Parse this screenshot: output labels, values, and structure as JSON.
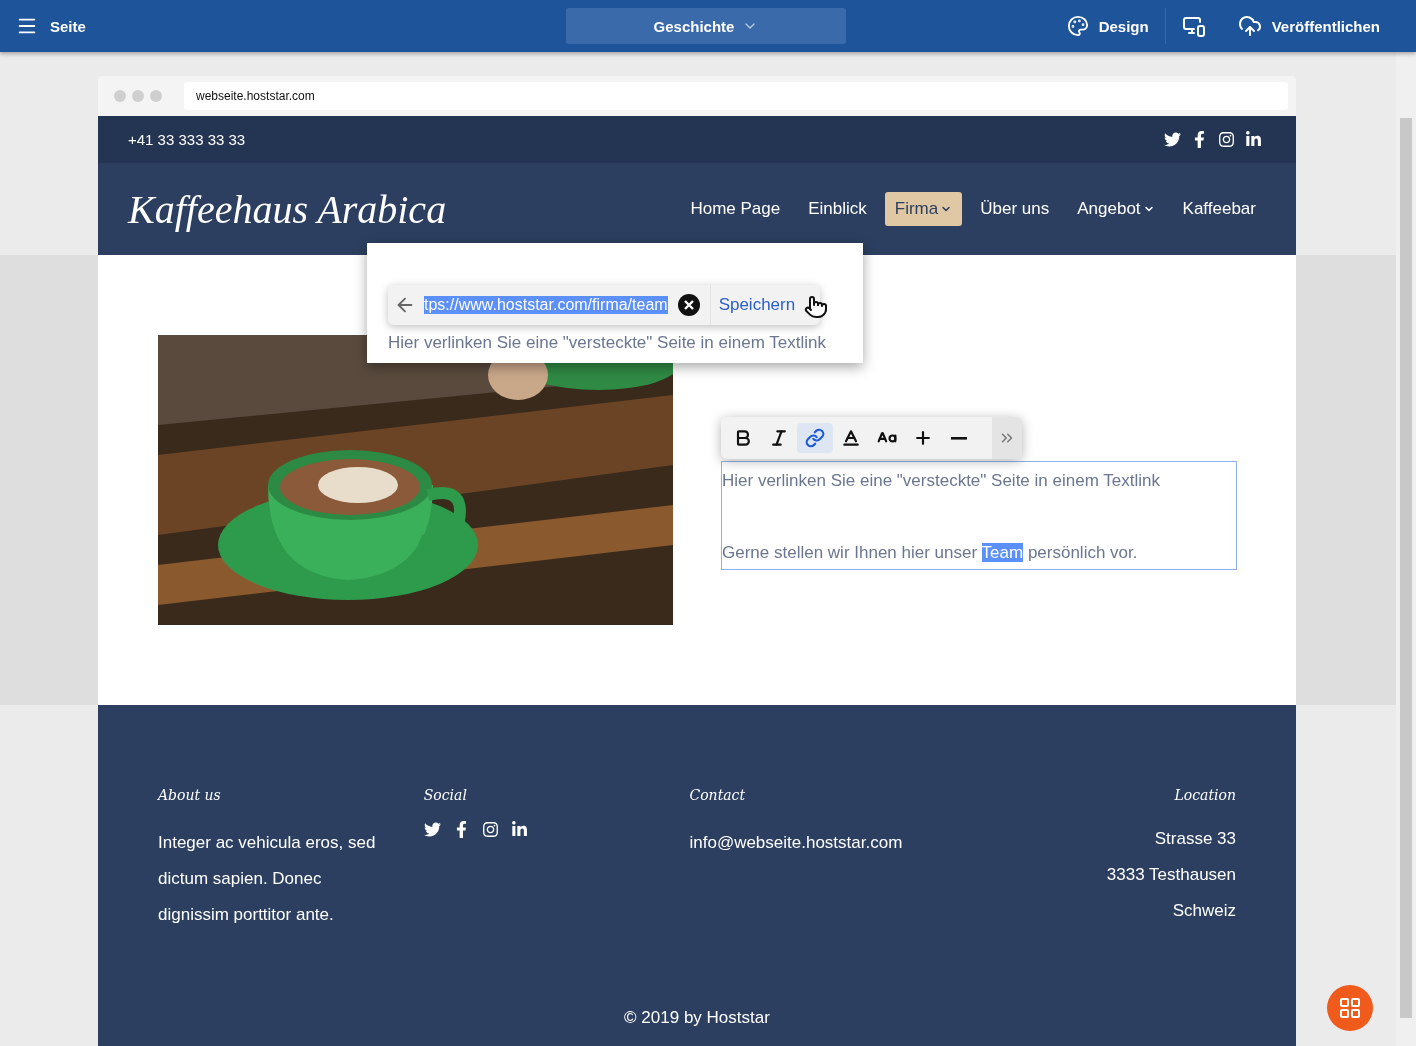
{
  "editor_bar": {
    "menu_label": "Seite",
    "page_selector": "Geschichte",
    "design_label": "Design",
    "publish_label": "Veröffentlichen"
  },
  "browser": {
    "address": "webseite.hoststar.com"
  },
  "site": {
    "phone": "+41 33 333 33 33",
    "logo": "Kaffeehaus Arabica",
    "nav": [
      {
        "label": "Home Page",
        "selected": false,
        "dropdown": false
      },
      {
        "label": "Einblick",
        "selected": false,
        "dropdown": false
      },
      {
        "label": "Firma",
        "selected": true,
        "dropdown": true
      },
      {
        "label": "Über uns",
        "selected": false,
        "dropdown": false
      },
      {
        "label": "Angebot",
        "selected": false,
        "dropdown": true
      },
      {
        "label": "Kaffeebar",
        "selected": false,
        "dropdown": false
      }
    ]
  },
  "content": {
    "link_editor": {
      "url": "tps://www.hoststar.com/firma/team",
      "save_label": "Speichern",
      "caption": "Hier verlinken Sie eine \"versteckte\" Seite in einem Textlink"
    },
    "text_block": {
      "toolbar": [
        {
          "kind": "bold",
          "active": false
        },
        {
          "kind": "italic",
          "active": false
        },
        {
          "kind": "link",
          "active": true
        },
        {
          "kind": "color",
          "active": false
        },
        {
          "kind": "size",
          "active": false
        },
        {
          "kind": "plus",
          "active": false
        },
        {
          "kind": "minus",
          "active": false
        },
        {
          "kind": "more",
          "active": false
        }
      ],
      "paragraph_1": "Hier verlinken Sie eine \"versteckte\" Seite in einem Textlink",
      "paragraph_2": {
        "before": "Gerne stellen wir Ihnen hier unser",
        "selection": "Team",
        "after": "persönlich vor."
      }
    }
  },
  "footer": {
    "columns": [
      {
        "kind": "text",
        "heading": "About us",
        "text": "Integer ac vehicula eros, sed dictum sapien. Donec dignissim porttitor ante."
      },
      {
        "kind": "social",
        "heading": "Social"
      },
      {
        "kind": "text",
        "heading": "Contact",
        "text": "info@webseite.hoststar.com"
      },
      {
        "kind": "lines",
        "heading": "Location",
        "lines": [
          "Strasse 33",
          "3333 Testhausen",
          "Schweiz"
        ]
      }
    ],
    "copyright": "© 2019 by Hoststar"
  }
}
